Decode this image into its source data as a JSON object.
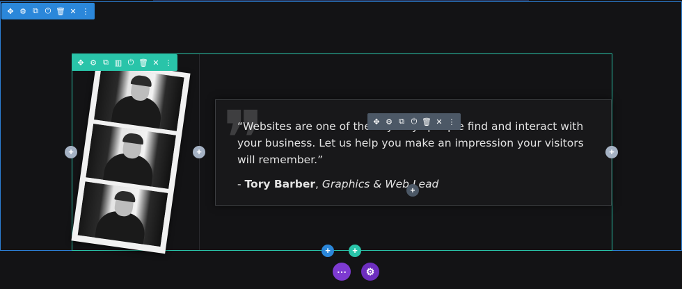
{
  "quote": {
    "text": "“Websites are one of the key ways people find and interact with your business. Let us help you make an impression your visitors will remember.”",
    "author_prefix": "- ",
    "author_name": "Tory Barber",
    "author_sep": ", ",
    "author_role": "Graphics & Web Lead",
    "mark": "❞"
  },
  "section_toolbar": {
    "icons": [
      "move-icon",
      "gear-icon",
      "duplicate-icon",
      "power-icon",
      "trash-icon",
      "close-icon",
      "more-icon"
    ],
    "glyphs": [
      "✥",
      "⚙",
      "⧉",
      "⏻",
      "🗑",
      "✕",
      "⋮"
    ]
  },
  "row_toolbar": {
    "icons": [
      "move-icon",
      "gear-icon",
      "duplicate-icon",
      "columns-icon",
      "power-icon",
      "trash-icon",
      "close-icon",
      "more-icon"
    ],
    "glyphs": [
      "✥",
      "⚙",
      "⧉",
      "▥",
      "⏻",
      "🗑",
      "✕",
      "⋮"
    ]
  },
  "module_toolbar": {
    "icons": [
      "move-icon",
      "gear-icon",
      "duplicate-icon",
      "power-icon",
      "trash-icon",
      "close-icon",
      "more-icon"
    ],
    "glyphs": [
      "✥",
      "⚙",
      "⧉",
      "⏻",
      "🗑",
      "✕",
      "⋮"
    ]
  },
  "add_glyph": "+",
  "fab": {
    "more": "⋯",
    "settings": "⚙"
  },
  "colors": {
    "section": "#2b87da",
    "row": "#29c4a9",
    "module": "#4c5866",
    "page": "#7d3ad1"
  }
}
